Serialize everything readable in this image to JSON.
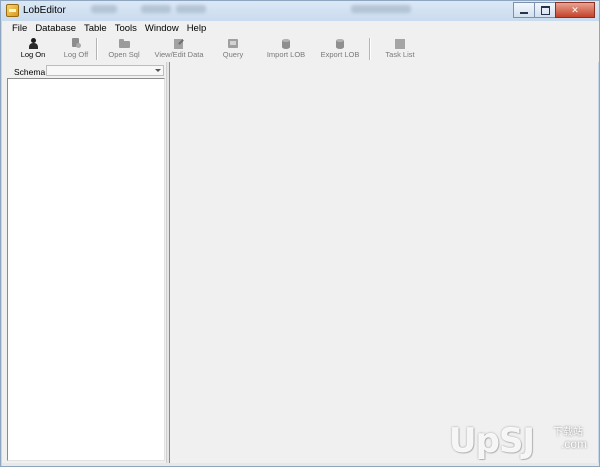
{
  "window": {
    "title": "LobEditor",
    "controls": {
      "minimize": "–",
      "maximize": "□",
      "close": "✕"
    }
  },
  "menubar": {
    "items": [
      "File",
      "Database",
      "Table",
      "Tools",
      "Window",
      "Help"
    ]
  },
  "toolbar": {
    "buttons": [
      {
        "label": "Log On",
        "icon": "person-icon",
        "enabled": true
      },
      {
        "label": "Log Off",
        "icon": "log-off-icon",
        "enabled": false
      },
      {
        "label": "Open Sql",
        "icon": "folder-icon",
        "enabled": false
      },
      {
        "label": "View/Edit Data",
        "icon": "edit-data-icon",
        "enabled": false
      },
      {
        "label": "Query",
        "icon": "query-icon",
        "enabled": false
      },
      {
        "label": "Import LOB",
        "icon": "import-lob-icon",
        "enabled": false
      },
      {
        "label": "Export LOB",
        "icon": "export-lob-icon",
        "enabled": false
      },
      {
        "label": "Task List",
        "icon": "task-list-icon",
        "enabled": false
      }
    ]
  },
  "left_panel": {
    "schema_label": "Schema",
    "schema_value": ""
  },
  "watermark": {
    "logo": "UpSJ",
    "cn": "下载站",
    "com": ".com"
  }
}
